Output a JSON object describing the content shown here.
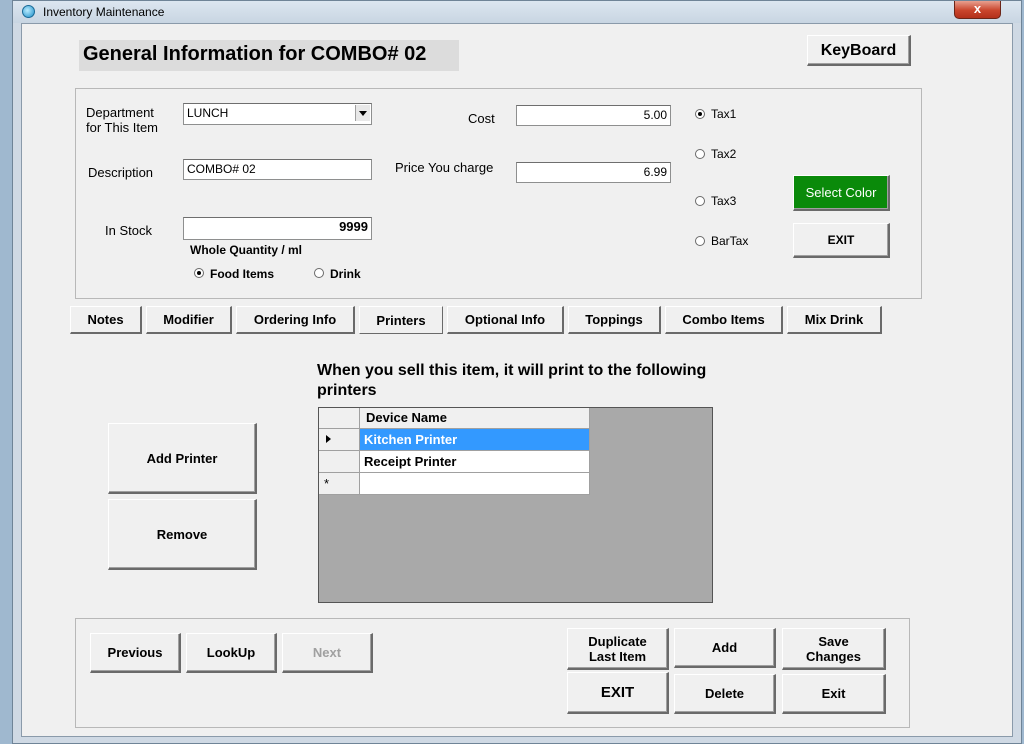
{
  "window": {
    "title": "Inventory Maintenance",
    "close_glyph": "x"
  },
  "header": {
    "title": "General Information for COMBO# 02",
    "keyboard_label": "KeyBoard"
  },
  "general": {
    "department_label_1": "Department",
    "department_label_2": "for This Item",
    "department_value": "LUNCH",
    "description_label": "Description",
    "description_value": "COMBO# 02",
    "instock_label": "In Stock",
    "instock_value": "9999",
    "whole_qty_label": "Whole Quantity / ml",
    "food_items_label": "Food Items",
    "drink_label": "Drink",
    "cost_label": "Cost",
    "cost_value": "5.00",
    "price_label": "Price You charge",
    "price_value": "6.99",
    "tax1_label": "Tax1",
    "tax2_label": "Tax2",
    "tax3_label": "Tax3",
    "bartax_label": "BarTax",
    "select_color_label": "Select Color",
    "select_color_bg": "#0a8a0a",
    "exit_label": "EXIT"
  },
  "tabs": [
    {
      "label": "Notes"
    },
    {
      "label": "Modifier"
    },
    {
      "label": "Ordering Info"
    },
    {
      "label": "Printers"
    },
    {
      "label": "Optional Info"
    },
    {
      "label": "Toppings"
    },
    {
      "label": "Combo Items"
    },
    {
      "label": "Mix Drink"
    }
  ],
  "printers": {
    "heading": "When you sell this item, it will print to the following printers",
    "add_printer_label": "Add Printer",
    "remove_label": "Remove",
    "column_header": "Device Name",
    "rows": [
      {
        "name": "Kitchen Printer"
      },
      {
        "name": "Receipt Printer"
      }
    ],
    "new_row_glyph": "*",
    "selection_color": "#3399ff"
  },
  "footer": {
    "previous_label": "Previous",
    "lookup_label": "LookUp",
    "next_label": "Next",
    "duplicate_label_1": "Duplicate",
    "duplicate_label_2": "Last Item",
    "add_label": "Add",
    "save_label_1": "Save",
    "save_label_2": "Changes",
    "exit_upper_label": "EXIT",
    "delete_label": "Delete",
    "exit_label": "Exit"
  }
}
